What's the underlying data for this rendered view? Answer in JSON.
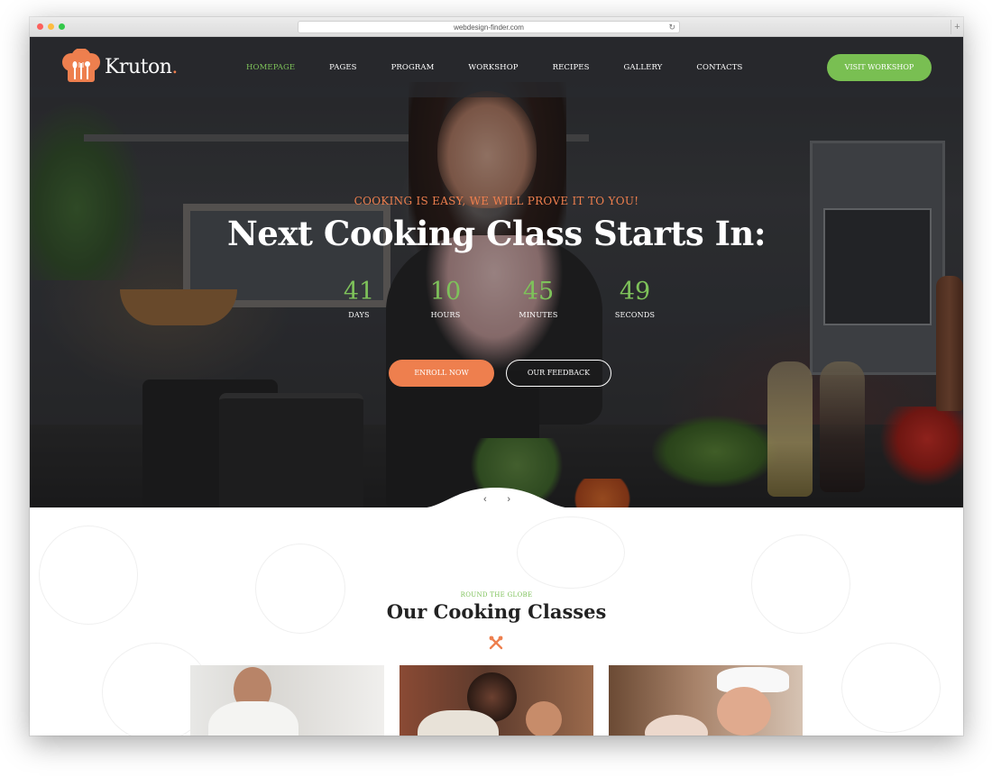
{
  "browser": {
    "url": "webdesign-finder.com",
    "reload_icon": "reload-icon",
    "new_tab_label": "+"
  },
  "header": {
    "logo_text": "Kruton",
    "logo_dot": ".",
    "nav": [
      {
        "label": "HOMEPAGE",
        "active": true
      },
      {
        "label": "PAGES",
        "active": false
      },
      {
        "label": "PROGRAM",
        "active": false
      },
      {
        "label": "WORKSHOP",
        "active": false
      },
      {
        "label": "RECIPES",
        "active": false
      },
      {
        "label": "GALLERY",
        "active": false
      },
      {
        "label": "CONTACTS",
        "active": false
      }
    ],
    "cta_label": "VISIT WORKSHOP"
  },
  "hero": {
    "tagline": "COOKING IS EASY, WE WILL PROVE IT TO YOU!",
    "title": "Next Cooking Class Starts In:",
    "countdown": [
      {
        "value": "41",
        "label": "DAYS"
      },
      {
        "value": "10",
        "label": "HOURS"
      },
      {
        "value": "45",
        "label": "MINUTES"
      },
      {
        "value": "49",
        "label": "SECONDS"
      }
    ],
    "enroll_label": "ENROLL NOW",
    "feedback_label": "OUR FEEDBACK",
    "prev_arrow": "‹",
    "next_arrow": "›"
  },
  "classes": {
    "subtitle": "ROUND THE GLOBE",
    "title": "Our Cooking Classes"
  },
  "colors": {
    "accent_green": "#79bf52",
    "accent_orange": "#ee7f4e",
    "nav_bg": "#282a2e",
    "title_dark": "#222222"
  }
}
